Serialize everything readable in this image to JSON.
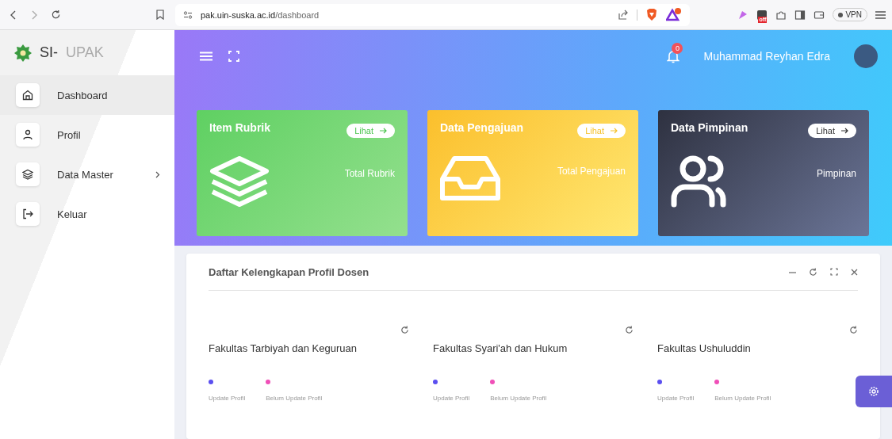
{
  "browser": {
    "url_host": "pak.uin-suska.ac.id",
    "url_path": "/dashboard",
    "extension_badge": "off",
    "vpn": "VPN"
  },
  "sidebar": {
    "brand_prefix": "SI-",
    "brand_name": "UPAK",
    "items": [
      {
        "label": "Dashboard",
        "kind": "home",
        "selected": true,
        "expandable": false
      },
      {
        "label": "Profil",
        "kind": "user",
        "selected": false,
        "expandable": false
      },
      {
        "label": "Data Master",
        "kind": "layers",
        "selected": false,
        "expandable": true
      },
      {
        "label": "Keluar",
        "kind": "logout",
        "selected": false,
        "expandable": false
      }
    ]
  },
  "topbar": {
    "notification_count": "0",
    "user_name": "Muhammad Reyhan Edra"
  },
  "cards": [
    {
      "title": "Item Rubrik",
      "button": "Lihat",
      "caption": "Total Rubrik",
      "kind": "layers"
    },
    {
      "title": "Data Pengajuan",
      "button": "Lihat",
      "caption": "Total Pengajuan",
      "kind": "inbox"
    },
    {
      "title": "Data Pimpinan",
      "button": "Lihat",
      "caption": "Pimpinan",
      "kind": "users"
    }
  ],
  "panel": {
    "title": "Daftar Kelengkapan Profil Dosen",
    "faculties": [
      {
        "name": "Fakultas Tarbiyah dan Keguruan",
        "legend": [
          {
            "label": "Update Profil",
            "color": "#5b4ff0"
          },
          {
            "label": "Belum Update Profil",
            "color": "#f04fb8"
          }
        ]
      },
      {
        "name": "Fakultas Syari'ah dan Hukum",
        "legend": [
          {
            "label": "Update Profil",
            "color": "#5b4ff0"
          },
          {
            "label": "Belum Update Profil",
            "color": "#f04fb8"
          }
        ]
      },
      {
        "name": "Fakultas Ushuluddin",
        "legend": [
          {
            "label": "Update Profil",
            "color": "#5b4ff0"
          },
          {
            "label": "Belum Update Profil",
            "color": "#f04fb8"
          }
        ]
      }
    ]
  }
}
